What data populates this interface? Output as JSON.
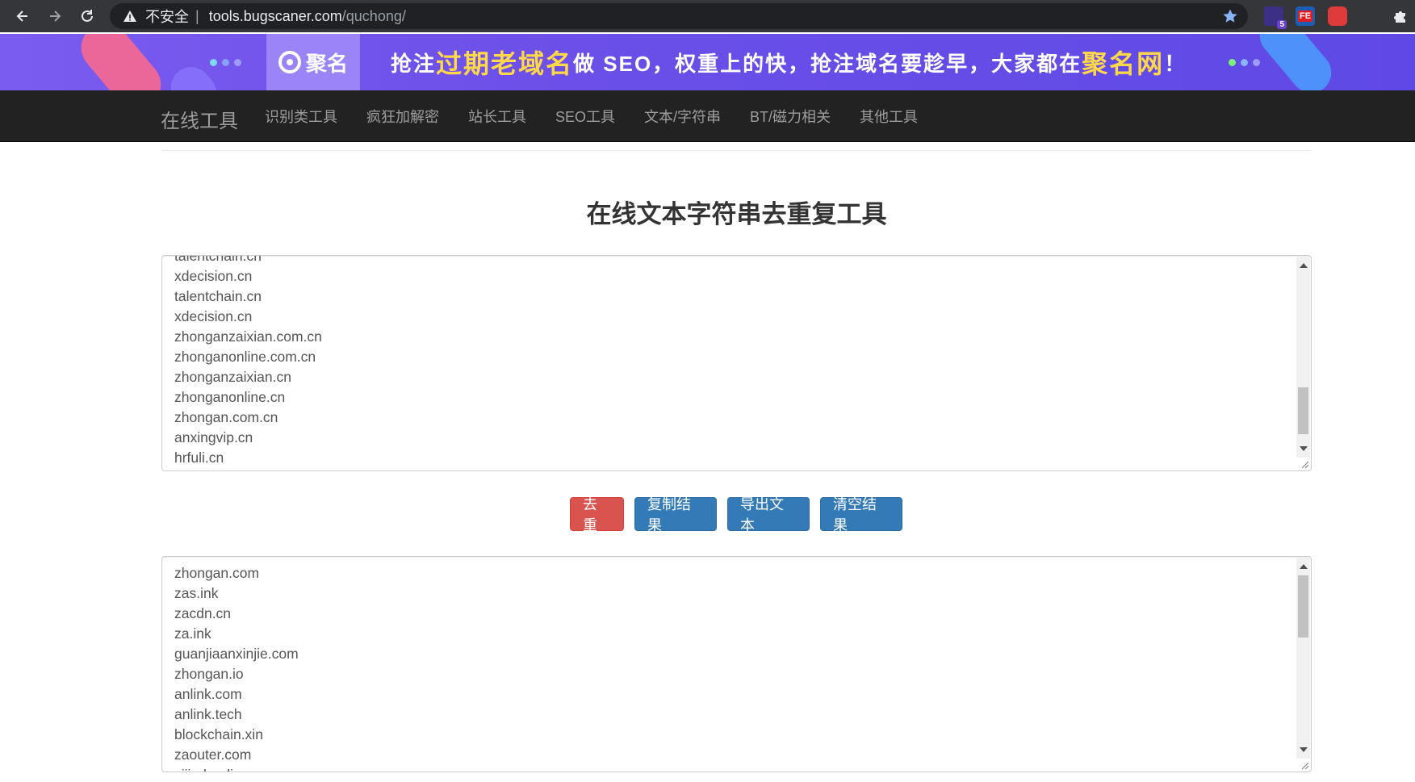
{
  "browser": {
    "insecure_label": "不安全",
    "separator": "|",
    "url_host": "tools.bugscaner.com",
    "url_path": "/quchong/",
    "ext_badge": "5",
    "ext_fe": "FE"
  },
  "banner": {
    "logo_text": "聚名",
    "slogan_part1": "抢注",
    "slogan_highlight1": "过期老域名",
    "slogan_part2": "做 SEO，权重上的快，抢注域名要趁早，大家都在",
    "slogan_highlight2": "聚名网",
    "slogan_end": "！"
  },
  "navbar": {
    "brand": "在线工具",
    "items": [
      "识别类工具",
      "疯狂加解密",
      "站长工具",
      "SEO工具",
      "文本/字符串",
      "BT/磁力相关",
      "其他工具"
    ]
  },
  "page": {
    "title": "在线文本字符串去重复工具"
  },
  "input_area": {
    "lines": [
      "talentchain.cn",
      "xdecision.cn",
      "talentchain.cn",
      "xdecision.cn",
      "zhonganzaixian.com.cn",
      "zhonganonline.com.cn",
      "zhonganzaixian.cn",
      "zhonganonline.cn",
      "zhongan.com.cn",
      "anxingvip.cn",
      "hrfuli.cn"
    ]
  },
  "buttons": {
    "dedupe": "去重",
    "copy": "复制结果",
    "export": "导出文本",
    "clear": "清空结果"
  },
  "output_area": {
    "lines": [
      "zhongan.com",
      "zas.ink",
      "zacdn.cn",
      "za.ink",
      "guanjiaanxinjie.com",
      "zhongan.io",
      "anlink.com",
      "anlink.tech",
      "blockchain.xin",
      "zaouter.com",
      "zijiadoudi.com"
    ]
  },
  "colors": {
    "danger": "#d9534f",
    "primary": "#337ab7",
    "navbar": "#222222"
  }
}
